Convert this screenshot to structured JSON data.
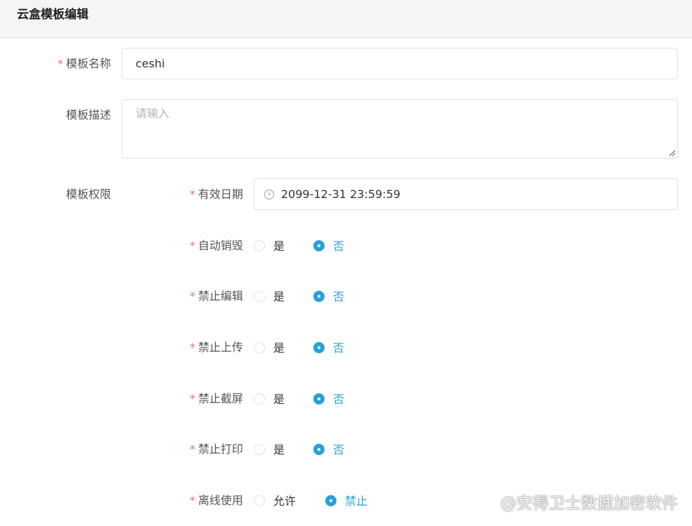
{
  "header": {
    "title": "云盒模板编辑"
  },
  "form": {
    "name": {
      "label": "模板名称",
      "required": "*",
      "value": "ceshi"
    },
    "desc": {
      "label": "模板描述",
      "placeholder": "请输入"
    },
    "perm": {
      "label": "模板权限"
    },
    "expiry": {
      "label": "有效日期",
      "required": "*",
      "value": "2099-12-31 23:59:59",
      "icon": "clock-icon"
    },
    "options": [
      {
        "key": "auto-destroy",
        "label": "自动销毁",
        "required": "*",
        "yes": "是",
        "no": "否",
        "selected": "no"
      },
      {
        "key": "no-edit",
        "label": "禁止编辑",
        "required": "*",
        "yes": "是",
        "no": "否",
        "selected": "no"
      },
      {
        "key": "no-upload",
        "label": "禁止上传",
        "required": "*",
        "yes": "是",
        "no": "否",
        "selected": "no"
      },
      {
        "key": "no-screenshot",
        "label": "禁止截屏",
        "required": "*",
        "yes": "是",
        "no": "否",
        "selected": "no"
      },
      {
        "key": "no-print",
        "label": "禁止打印",
        "required": "*",
        "yes": "是",
        "no": "否",
        "selected": "no"
      },
      {
        "key": "offline-use",
        "label": "离线使用",
        "required": "*",
        "yes": "允许",
        "no": "禁止",
        "selected": "no"
      }
    ]
  },
  "watermark": {
    "text": "@安得卫士数据加密软件",
    "icon": "paw-icon"
  },
  "colors": {
    "accent": "#27a2d8",
    "required": "#f56c6c",
    "border": "#dcdfe6"
  }
}
